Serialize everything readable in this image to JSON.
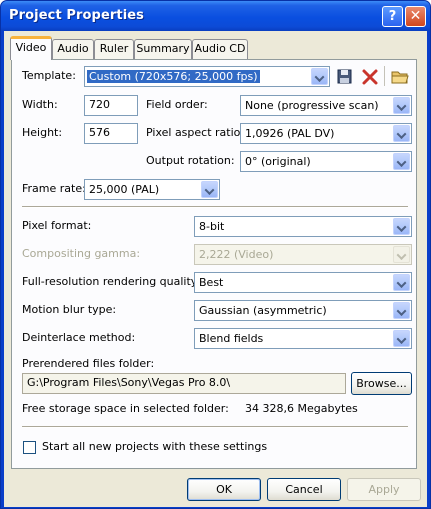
{
  "window": {
    "title": "Project Properties",
    "help": "?",
    "close": "✕"
  },
  "tabs": [
    "Video",
    "Audio",
    "Ruler",
    "Summary",
    "Audio CD"
  ],
  "video": {
    "template_label": "Template:",
    "template_value": "Custom (720x576; 25,000 fps)",
    "width_label": "Width:",
    "width_value": "720",
    "height_label": "Height:",
    "height_value": "576",
    "field_order_label": "Field order:",
    "field_order_value": "None (progressive scan)",
    "pixel_aspect_label": "Pixel aspect ratio:",
    "pixel_aspect_value": "1,0926 (PAL DV)",
    "output_rotation_label": "Output rotation:",
    "output_rotation_value": "0° (original)",
    "frame_rate_label": "Frame rate:",
    "frame_rate_value": "25,000 (PAL)",
    "pixel_format_label": "Pixel format:",
    "pixel_format_value": "8-bit",
    "compositing_gamma_label": "Compositing gamma:",
    "compositing_gamma_value": "2,222 (Video)",
    "full_res_label": "Full-resolution rendering quality:",
    "full_res_value": "Best",
    "motion_blur_label": "Motion blur type:",
    "motion_blur_value": "Gaussian (asymmetric)",
    "deinterlace_label": "Deinterlace method:",
    "deinterlace_value": "Blend fields",
    "prerendered_label": "Prerendered files folder:",
    "prerendered_value": "G:\\Program Files\\Sony\\Vegas Pro 8.0\\",
    "browse_label": "Browse...",
    "free_space_label": "Free storage space in selected folder:",
    "free_space_value": "34 328,6 Megabytes",
    "start_all_label": "Start all new projects with these settings"
  },
  "buttons": {
    "ok": "OK",
    "cancel": "Cancel",
    "apply": "Apply"
  },
  "icons": [
    "save-icon",
    "delete-icon",
    "folder-icon"
  ]
}
